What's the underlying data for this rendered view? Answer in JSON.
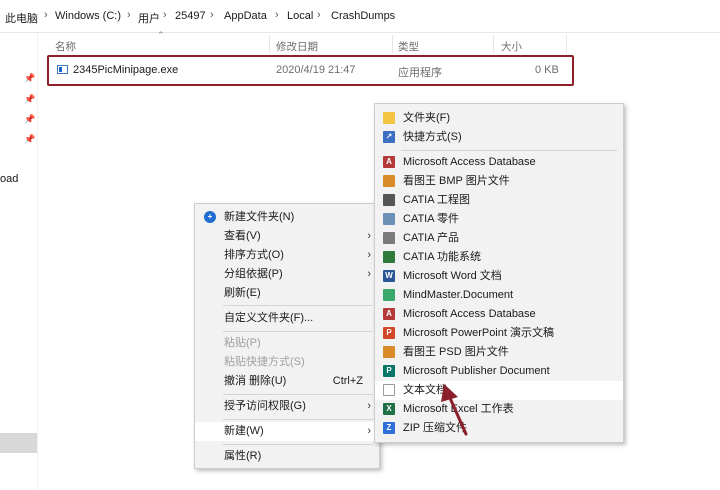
{
  "breadcrumb": [
    "此电脑",
    "Windows (C:)",
    "用户",
    "25497",
    "AppData",
    "Local",
    "CrashDumps"
  ],
  "breadcrumb_separator": "›",
  "nav": {
    "partial_label": "oad"
  },
  "columns": {
    "name": "名称",
    "modified": "修改日期",
    "type": "类型",
    "size": "大小"
  },
  "file": {
    "name": "2345PicMinipage.exe",
    "modified": "2020/4/19 21:47",
    "type": "应用程序",
    "size": "0 KB"
  },
  "context_menu": {
    "items": [
      {
        "label": "新建文件夹(N)"
      },
      {
        "label": "查看(V)",
        "arrow": "›"
      },
      {
        "label": "排序方式(O)",
        "arrow": "›"
      },
      {
        "label": "分组依据(P)",
        "arrow": "›"
      },
      {
        "label": "刷新(E)"
      },
      {
        "label": "自定义文件夹(F)..."
      },
      {
        "label": "粘贴(P)"
      },
      {
        "label": "粘贴快捷方式(S)"
      },
      {
        "label": "撤消 删除(U)",
        "shortcut": "Ctrl+Z"
      },
      {
        "label": "授予访问权限(G)",
        "arrow": "›"
      },
      {
        "label": "新建(W)",
        "arrow": "›"
      },
      {
        "label": "属性(R)"
      }
    ]
  },
  "new_submenu": {
    "items": [
      {
        "label": "文件夹(F)"
      },
      {
        "label": "快捷方式(S)"
      },
      {
        "label": "Microsoft Access Database"
      },
      {
        "label": "看图王 BMP 图片文件"
      },
      {
        "label": "CATIA 工程图"
      },
      {
        "label": "CATIA 零件"
      },
      {
        "label": "CATIA 产品"
      },
      {
        "label": "CATIA 功能系统"
      },
      {
        "label": "Microsoft Word 文档"
      },
      {
        "label": "MindMaster.Document"
      },
      {
        "label": "Microsoft Access Database"
      },
      {
        "label": "Microsoft PowerPoint 演示文稿"
      },
      {
        "label": "看图王 PSD 图片文件"
      },
      {
        "label": "Microsoft Publisher Document"
      },
      {
        "label": "文本文档"
      },
      {
        "label": "Microsoft Excel 工作表"
      },
      {
        "label": "ZIP 压缩文件"
      }
    ]
  },
  "colors": {
    "highlight_border": "#8b1f2c",
    "arrow": "#8b1f2c",
    "menu_bg": "#f2f2f2"
  }
}
